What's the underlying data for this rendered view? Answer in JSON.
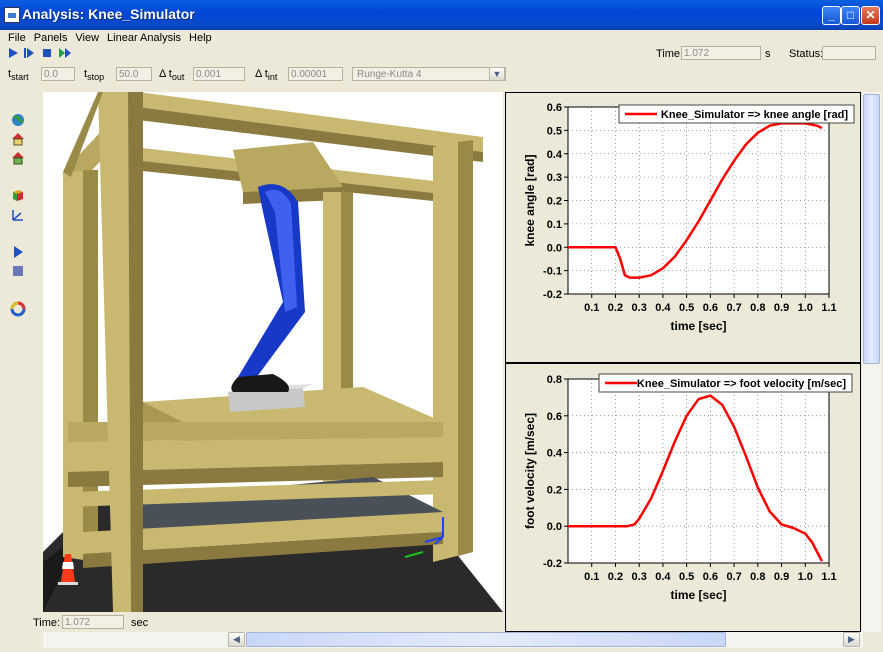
{
  "window": {
    "title": "Analysis: Knee_Simulator"
  },
  "menu": {
    "items": [
      "File",
      "Panels",
      "View",
      "Linear Analysis",
      "Help"
    ]
  },
  "toolbar": {
    "time_label": "Time:",
    "time_value": "1.072",
    "time_unit": "s",
    "status_label": "Status:",
    "status_value": "",
    "tstart_label": "t",
    "tstart_sub": "start",
    "tstart_value": "0.0",
    "tstop_label": "t",
    "tstop_sub": "stop",
    "tstop_value": "50.0",
    "tout_label": "Δ t",
    "tout_sub": "out",
    "tout_value": "0.001",
    "tint_label": "Δ t",
    "tint_sub": "int",
    "tint_value": "0.00001",
    "solver_value": "Runge-Kutta 4"
  },
  "bottom": {
    "time_label": "Time:",
    "time_value": "1.072",
    "time_unit": "sec"
  },
  "icons": {
    "play": "play-icon",
    "step": "step-icon",
    "stop": "stop-icon",
    "forward": "forward-icon"
  },
  "chart_data": [
    {
      "type": "line",
      "legend": "Knee_Simulator => knee angle [rad]",
      "xlabel": "time [sec]",
      "ylabel": "knee angle [rad]",
      "xlim": [
        0,
        1.1
      ],
      "ylim": [
        -0.2,
        0.6
      ],
      "xticks": [
        "0.1",
        "0.2",
        "0.3",
        "0.4",
        "0.5",
        "0.6",
        "0.7",
        "0.8",
        "0.9",
        "1.0",
        "1.1"
      ],
      "yticks": [
        "-0.2",
        "-0.1",
        "0.0",
        "0.1",
        "0.2",
        "0.3",
        "0.4",
        "0.5",
        "0.6"
      ],
      "color": "#ff0000",
      "x": [
        0,
        0.1,
        0.2,
        0.22,
        0.24,
        0.26,
        0.3,
        0.35,
        0.4,
        0.45,
        0.5,
        0.55,
        0.6,
        0.65,
        0.7,
        0.75,
        0.8,
        0.85,
        0.9,
        0.95,
        1.0,
        1.05,
        1.07
      ],
      "y": [
        0.0,
        0.0,
        0.0,
        -0.05,
        -0.12,
        -0.13,
        -0.13,
        -0.12,
        -0.09,
        -0.04,
        0.03,
        0.11,
        0.2,
        0.29,
        0.37,
        0.44,
        0.49,
        0.52,
        0.53,
        0.53,
        0.53,
        0.52,
        0.51
      ]
    },
    {
      "type": "line",
      "legend": "Knee_Simulator => foot velocity [m/sec]",
      "xlabel": "time [sec]",
      "ylabel": "foot velocity [m/sec]",
      "xlim": [
        0,
        1.1
      ],
      "ylim": [
        -0.2,
        0.8
      ],
      "xticks": [
        "0.1",
        "0.2",
        "0.3",
        "0.4",
        "0.5",
        "0.6",
        "0.7",
        "0.8",
        "0.9",
        "1.0",
        "1.1"
      ],
      "yticks": [
        "-0.2",
        "0.0",
        "0.2",
        "0.4",
        "0.6",
        "0.8"
      ],
      "color": "#ff0000",
      "x": [
        0,
        0.1,
        0.2,
        0.25,
        0.28,
        0.3,
        0.35,
        0.4,
        0.45,
        0.5,
        0.55,
        0.6,
        0.65,
        0.7,
        0.75,
        0.8,
        0.85,
        0.9,
        0.95,
        1.0,
        1.03,
        1.05,
        1.07
      ],
      "y": [
        0.0,
        0.0,
        0.0,
        0.0,
        0.01,
        0.04,
        0.15,
        0.3,
        0.46,
        0.6,
        0.69,
        0.71,
        0.66,
        0.54,
        0.38,
        0.21,
        0.08,
        0.01,
        -0.01,
        -0.04,
        -0.09,
        -0.14,
        -0.19
      ]
    }
  ]
}
